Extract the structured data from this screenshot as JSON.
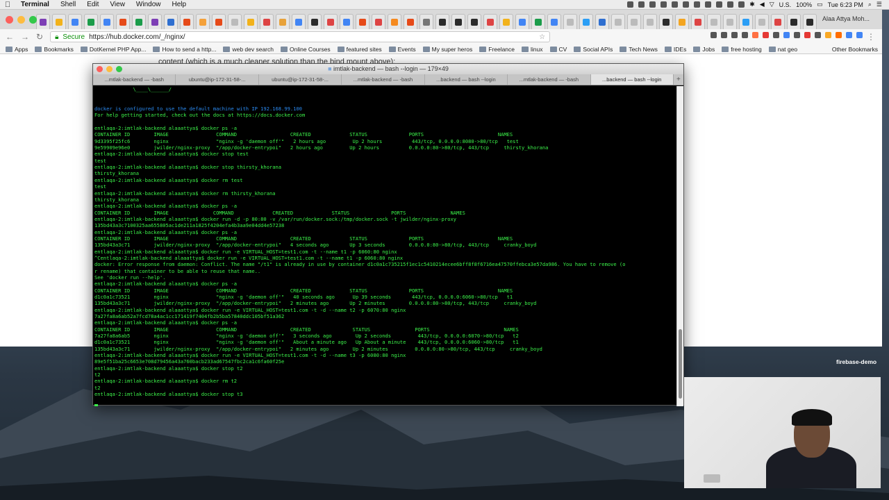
{
  "menubar": {
    "app_name": "Terminal",
    "items": [
      "Shell",
      "Edit",
      "View",
      "Window",
      "Help"
    ],
    "battery": "100%",
    "locale": "U.S.",
    "clock": "Tue 6:23 PM"
  },
  "browser": {
    "profile_name": "Alaa Attya Moh...",
    "secure_label": "Secure",
    "url": "https://hub.docker.com/_/nginx/",
    "bookmarks": [
      "Apps",
      "Bookmarks",
      "DotKernel PHP App...",
      "How to send a http...",
      "web dev search",
      "Online Courses",
      "featured sites",
      "Events",
      "My super heros",
      "Freelance",
      "linux",
      "CV",
      "Social APIs",
      "Tech News",
      "IDEs",
      "Jobs",
      "free hosting",
      "nat geo"
    ],
    "other_bookmarks": "Other Bookmarks",
    "page_text": "content (which is a much cleaner solution than the bind mount above):",
    "tab_favicon_colors": [
      "#7d3fb5",
      "#f2b21b",
      "#4285f4",
      "#1b9c4a",
      "#4285f4",
      "#e64a19",
      "#1b9c4a",
      "#7d3fb5",
      "#2f6fd0",
      "#e64a19",
      "#f4a13a",
      "#e64a19",
      "#bbbbbb",
      "#f2b21b",
      "#d44",
      "#e8a23a",
      "#4285f4",
      "#2b2b2b",
      "#d44",
      "#4285f4",
      "#e64a19",
      "#d44",
      "#f58a1f",
      "#e64a19",
      "#777777",
      "#2b2b2b",
      "#2b2b2b",
      "#2b2b2b",
      "#d44",
      "#f2b21b",
      "#4285f4",
      "#1b9c4a",
      "#4285f4",
      "#bbbbbb",
      "#2b9ef5",
      "#2f6fd0",
      "#bbbbbb",
      "#bbbbbb",
      "#bbbbbb",
      "#2b2b2b",
      "#f3a521",
      "#d44",
      "#bbbbbb",
      "#bbbbbb",
      "#2b9ef5",
      "#bbbbbb",
      "#d44",
      "#2b2b2b",
      "#2b2b2b"
    ]
  },
  "terminal": {
    "title": "imtlak-backend — bash --login — 179×49",
    "tabs": [
      "...mtlak-backend — -bash",
      "ubuntu@ip-172-31-58-...",
      "ubuntu@ip-172-31-58-...",
      "...mtlak-backend — -bash",
      "...backend — bash --login",
      "...mtlak-backend — -bash",
      "...backend — bash --login"
    ],
    "active_tab": 6,
    "lines": [
      "             \\____\\______/",
      "",
      "",
      "docker is configured to use the default machine with IP 192.168.99.100",
      "For help getting started, check out the docs at https://docs.docker.com",
      "",
      "entlaqa-2:imtlak-backend alaaattya$ docker ps -a",
      "CONTAINER ID        IMAGE                COMMAND                  CREATED             STATUS              PORTS                         NAMES",
      "9d3395f25fc6        nginx                \"nginx -g 'daemon off'\"   2 hours ago         Up 2 hours          443/tcp, 0.0.0.0:8080->80/tcp   test",
      "9e59909e96e0        jwilder/nginx-proxy  \"/app/docker-entrypoi\"   2 hours ago         Up 2 hours          0.0.0.0:80->80/tcp, 443/tcp     thirsty_khorana",
      "entlaqa-2:imtlak-backend alaaattya$ docker stop test",
      "test",
      "entlaqa-2:imtlak-backend alaaattya$ docker stop thirsty_khorana",
      "thirsty_khorana",
      "entlaqa-2:imtlak-backend alaaattya$ docker rm test",
      "test",
      "entlaqa-2:imtlak-backend alaaattya$ docker rm thirsty_khorana",
      "thirsty_khorana",
      "entlaqa-2:imtlak-backend alaaattya$ docker ps -a",
      "CONTAINER ID        IMAGE               COMMAND             CREATED             STATUS              PORTS               NAMES",
      "entlaqa-2:imtlak-backend alaaattya$ docker run -d -p 80:80 -v /var/run/docker.sock:/tmp/docker.sock -t jwilder/nginx-proxy",
      "135bd43a3c7100325aa655805ac1de211a1825f4204efa4b3aa9e04dd4e57238",
      "entlaqa-2:imtlak-backend alaaattya$ docker ps -a",
      "CONTAINER ID        IMAGE                COMMAND                  CREATED             STATUS              PORTS                         NAMES",
      "135bd43a3c71        jwilder/nginx-proxy  \"/app/docker-entrypoi\"   4 seconds ago       Up 3 seconds        0.0.0.0:80->80/tcp, 443/tcp     cranky_boyd",
      "entlaqa-2:imtlak-backend alaaattya$ docker run -e VIRTUAL_HOST=test1.com -t --name t1 -p 6060:80 nginx",
      "^Centlaqa-2:imtlak-backend alaaattya$ docker run -e VIRTUAL_HOST=test1.com -t --name t1 -p 6060:80 nginx",
      "docker: Error response from daemon: Conflict. The name \"/t1\" is already in use by container d1c0a1c735215f1ec1c5410214ecee6bff8f8f6716ea47570ffebca3e57da986. You have to remove (o",
      "r rename) that container to be able to reuse that name..",
      "See 'docker run --help'.",
      "entlaqa-2:imtlak-backend alaaattya$ docker ps -a",
      "CONTAINER ID        IMAGE                COMMAND                  CREATED             STATUS              PORTS                         NAMES",
      "d1c0a1c73521        nginx                \"nginx -g 'daemon off'\"   40 seconds ago      Up 39 seconds       443/tcp, 0.0.0.0:6060->80/tcp   t1",
      "135bd43a3c71        jwilder/nginx-proxy  \"/app/docker-entrypoi\"   2 minutes ago       Up 2 minutes        0.0.0.0:80->80/tcp, 443/tcp     cranky_boyd",
      "entlaqa-2:imtlak-backend alaaattya$ docker run -e VIRTUAL_HOST=test1.com -t -d --name t2 -p 6070:80 nginx",
      "7a27fa8a6ab52a7fcd78a4ac1cc171419f7404fb2b5ba57840ddc105bf51a362",
      "entlaqa-2:imtlak-backend alaaattya$ docker ps -a",
      "CONTAINER ID        IMAGE                COMMAND                  CREATED              STATUS               PORTS                         NAMES",
      "7a27fa8a6ab5        nginx                \"nginx -g 'daemon off'\"   3 seconds ago        Up 2 seconds         443/tcp, 0.0.0.0:6070->80/tcp   t2",
      "d1c0a1c73521        nginx                \"nginx -g 'daemon off'\"   About a minute ago   Up About a minute    443/tcp, 0.0.0.0:6060->80/tcp   t1",
      "135bd43a3c71        jwilder/nginx-proxy  \"/app/docker-entrypoi\"   2 minutes ago        Up 2 minutes         0.0.0.0:80->80/tcp, 443/tcp     cranky_boyd",
      "entlaqa-2:imtlak-backend alaaattya$ docker run -e VIRTUAL_HOST=test1.com -t -d --name t3 -p 6080:80 nginx",
      "89e5f51ba25c6653e708d79456a43a760bacb233ad67547fbc2ca1c6fa60f25e",
      "entlaqa-2:imtlak-backend alaaattya$ docker stop t2",
      "t2",
      "entlaqa-2:imtlak-backend alaaattya$ docker rm t2",
      "t2",
      "entlaqa-2:imtlak-backend alaaattya$ docker stop t3",
      ""
    ]
  },
  "desktop": {
    "label": "firebase-demo"
  }
}
